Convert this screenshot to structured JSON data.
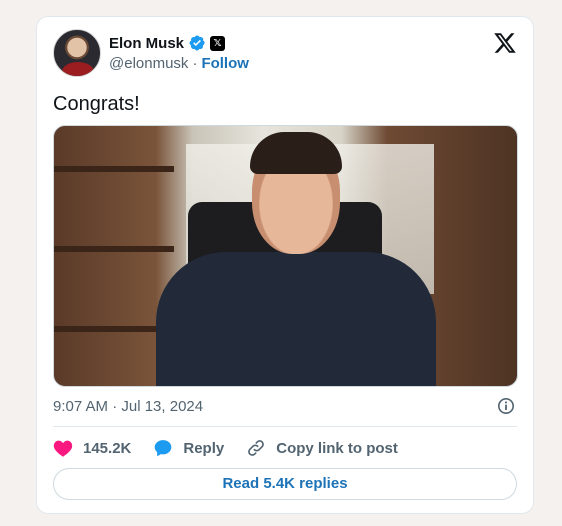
{
  "author": {
    "display_name": "Elon Musk",
    "handle": "@elonmusk",
    "separator": "·",
    "follow_label": "Follow",
    "x_badge": "𝕏"
  },
  "tweet": {
    "text": "Congrats!",
    "timestamp": "9:07 AM · Jul 13, 2024"
  },
  "actions": {
    "like_count": "145.2K",
    "reply_label": "Reply",
    "copy_link_label": "Copy link to post"
  },
  "footer": {
    "read_replies_label": "Read 5.4K replies"
  },
  "icons": {
    "logo": "x-logo",
    "verified": "verified-badge-icon",
    "like": "heart-icon",
    "reply": "speech-bubble-icon",
    "copy": "link-icon",
    "info": "info-icon"
  },
  "colors": {
    "accent": "#1d73b8",
    "verified": "#1d9bf0",
    "like": "#f91880",
    "reply": "#1d9bf0",
    "muted": "#536471",
    "background": "#f5f1ee"
  }
}
